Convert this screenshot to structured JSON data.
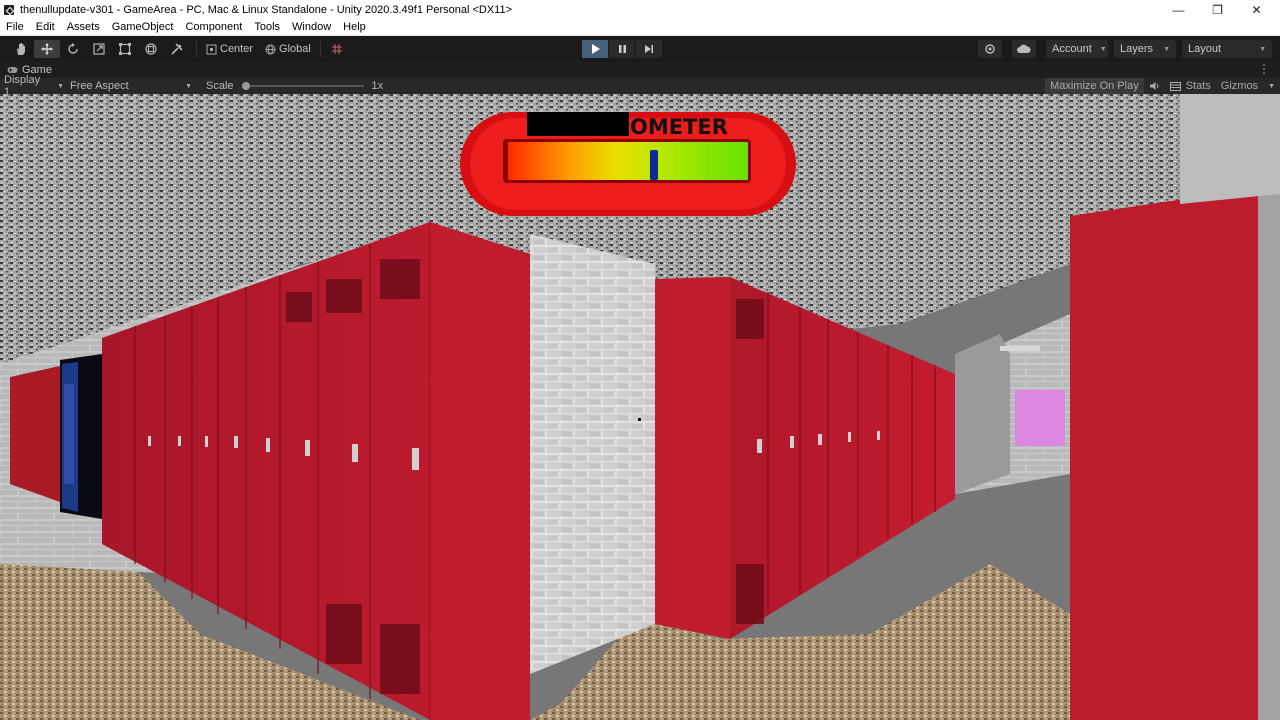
{
  "window": {
    "title": "thenullupdate-v301 - GameArea - PC, Mac & Linux Standalone - Unity 2020.3.49f1 Personal <DX11>",
    "minimize": "—",
    "maximize": "❐",
    "close": "✕"
  },
  "menu": {
    "items": [
      "File",
      "Edit",
      "Assets",
      "GameObject",
      "Component",
      "Tools",
      "Window",
      "Help"
    ]
  },
  "toolbar": {
    "tool_icons": [
      "hand-tool-icon",
      "move-tool-icon",
      "rotate-tool-icon",
      "scale-tool-icon",
      "rect-tool-icon",
      "transform-tool-icon",
      "custom-tool-icon"
    ],
    "pivot_label": "Center",
    "space_label": "Global",
    "play_state": "playing",
    "account_label": "Account",
    "layers_label": "Layers",
    "layout_label": "Layout"
  },
  "tab": {
    "label": "Game"
  },
  "gameview": {
    "display_label": "Display 1",
    "aspect_label": "Free Aspect",
    "scale_label": "Scale",
    "scale_value": "1x",
    "maximize_label": "Maximize On Play",
    "stats_label": "Stats",
    "gizmos_label": "Gizmos"
  },
  "hud": {
    "meter_label": "OMETER",
    "meter_level": 0.45
  },
  "colors": {
    "play_active": "#46607c",
    "locker_red": "#b0182a",
    "meter_frame": "#d80e12"
  }
}
